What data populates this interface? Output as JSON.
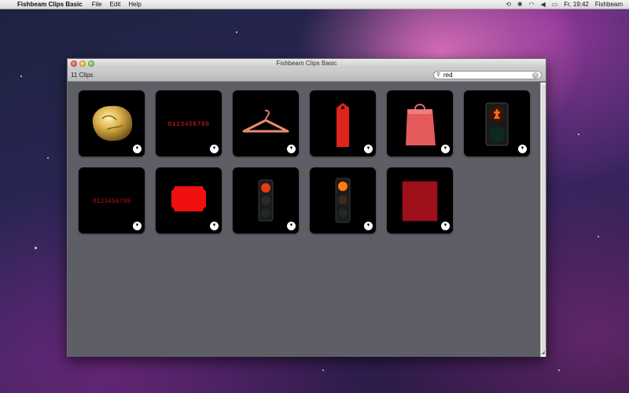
{
  "menubar": {
    "apple_icon": "apple-icon",
    "app_name": "Fishbeam Clips Basic",
    "menus": [
      "File",
      "Edit",
      "Help"
    ],
    "clock": "Fr. 19:42",
    "user": "Fishbeam"
  },
  "window": {
    "title": "Fishbeam Clips Basic",
    "clip_count": "11 Clips",
    "search": {
      "value": "red",
      "placeholder": ""
    }
  },
  "clips": [
    {
      "name": "gold-nugget"
    },
    {
      "name": "red-digital-numbers",
      "text": "0123456789"
    },
    {
      "name": "clothes-hanger"
    },
    {
      "name": "red-tag"
    },
    {
      "name": "red-shopping-bag"
    },
    {
      "name": "pedestrian-traffic-light"
    },
    {
      "name": "red-digital-numbers-2",
      "text": "0123456789"
    },
    {
      "name": "red-ticket"
    },
    {
      "name": "traffic-light-red"
    },
    {
      "name": "traffic-light-red-amber"
    },
    {
      "name": "red-paper-texture"
    }
  ],
  "colors": {
    "content_bg": "#5e5f66",
    "accent_red": "#e0231c"
  }
}
